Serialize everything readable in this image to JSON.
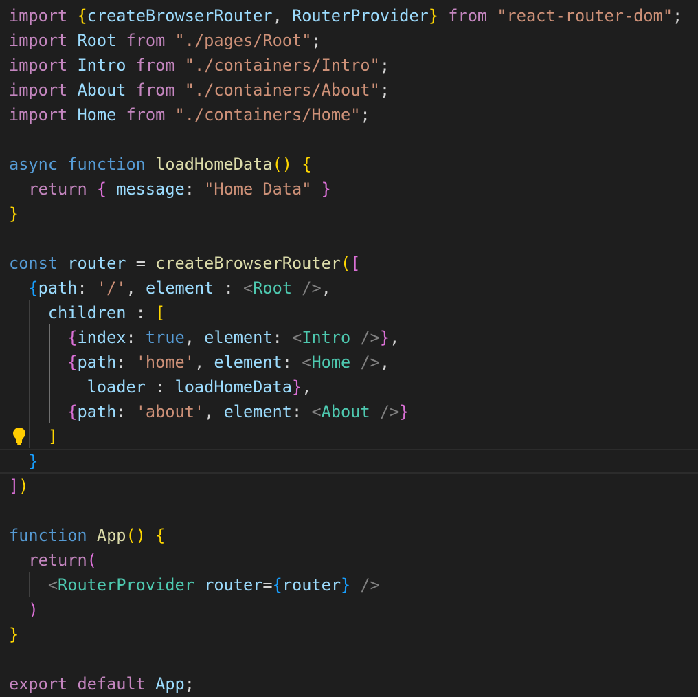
{
  "editor": {
    "language": "javascript",
    "lines": [
      [
        {
          "t": "import",
          "c": "kw"
        },
        {
          "t": " ",
          "c": "pun"
        },
        {
          "t": "{",
          "c": "b1"
        },
        {
          "t": "createBrowserRouter",
          "c": "var"
        },
        {
          "t": ", ",
          "c": "pun"
        },
        {
          "t": "RouterProvider",
          "c": "var"
        },
        {
          "t": "}",
          "c": "b1"
        },
        {
          "t": " ",
          "c": "pun"
        },
        {
          "t": "from",
          "c": "kw"
        },
        {
          "t": " ",
          "c": "pun"
        },
        {
          "t": "\"react-router-dom\"",
          "c": "str"
        },
        {
          "t": ";",
          "c": "pun"
        }
      ],
      [
        {
          "t": "import",
          "c": "kw"
        },
        {
          "t": " ",
          "c": "pun"
        },
        {
          "t": "Root",
          "c": "var"
        },
        {
          "t": " ",
          "c": "pun"
        },
        {
          "t": "from",
          "c": "kw"
        },
        {
          "t": " ",
          "c": "pun"
        },
        {
          "t": "\"./pages/Root\"",
          "c": "str"
        },
        {
          "t": ";",
          "c": "pun"
        }
      ],
      [
        {
          "t": "import",
          "c": "kw"
        },
        {
          "t": " ",
          "c": "pun"
        },
        {
          "t": "Intro",
          "c": "var"
        },
        {
          "t": " ",
          "c": "pun"
        },
        {
          "t": "from",
          "c": "kw"
        },
        {
          "t": " ",
          "c": "pun"
        },
        {
          "t": "\"./containers/Intro\"",
          "c": "str"
        },
        {
          "t": ";",
          "c": "pun"
        }
      ],
      [
        {
          "t": "import",
          "c": "kw"
        },
        {
          "t": " ",
          "c": "pun"
        },
        {
          "t": "About",
          "c": "var"
        },
        {
          "t": " ",
          "c": "pun"
        },
        {
          "t": "from",
          "c": "kw"
        },
        {
          "t": " ",
          "c": "pun"
        },
        {
          "t": "\"./containers/About\"",
          "c": "str"
        },
        {
          "t": ";",
          "c": "pun"
        }
      ],
      [
        {
          "t": "import",
          "c": "kw"
        },
        {
          "t": " ",
          "c": "pun"
        },
        {
          "t": "Home",
          "c": "var"
        },
        {
          "t": " ",
          "c": "pun"
        },
        {
          "t": "from",
          "c": "kw"
        },
        {
          "t": " ",
          "c": "pun"
        },
        {
          "t": "\"./containers/Home\"",
          "c": "str"
        },
        {
          "t": ";",
          "c": "pun"
        }
      ],
      [],
      [
        {
          "t": "async",
          "c": "st"
        },
        {
          "t": " ",
          "c": "pun"
        },
        {
          "t": "function",
          "c": "st"
        },
        {
          "t": " ",
          "c": "pun"
        },
        {
          "t": "loadHomeData",
          "c": "fn"
        },
        {
          "t": "()",
          "c": "b1"
        },
        {
          "t": " ",
          "c": "pun"
        },
        {
          "t": "{",
          "c": "b1"
        }
      ],
      [
        {
          "t": "  ",
          "c": "pun"
        },
        {
          "t": "return",
          "c": "kw"
        },
        {
          "t": " ",
          "c": "pun"
        },
        {
          "t": "{",
          "c": "b2"
        },
        {
          "t": " ",
          "c": "pun"
        },
        {
          "t": "message",
          "c": "var"
        },
        {
          "t": ": ",
          "c": "pun"
        },
        {
          "t": "\"Home Data\"",
          "c": "str"
        },
        {
          "t": " ",
          "c": "pun"
        },
        {
          "t": "}",
          "c": "b2"
        }
      ],
      [
        {
          "t": "}",
          "c": "b1"
        }
      ],
      [],
      [
        {
          "t": "const",
          "c": "st"
        },
        {
          "t": " ",
          "c": "pun"
        },
        {
          "t": "router",
          "c": "var"
        },
        {
          "t": " = ",
          "c": "pun"
        },
        {
          "t": "createBrowserRouter",
          "c": "fn"
        },
        {
          "t": "(",
          "c": "b1"
        },
        {
          "t": "[",
          "c": "b2"
        }
      ],
      [
        {
          "t": "  ",
          "c": "pun"
        },
        {
          "t": "{",
          "c": "b3"
        },
        {
          "t": "path",
          "c": "var"
        },
        {
          "t": ": ",
          "c": "pun"
        },
        {
          "t": "'/'",
          "c": "str"
        },
        {
          "t": ", ",
          "c": "pun"
        },
        {
          "t": "element",
          "c": "var"
        },
        {
          "t": " : ",
          "c": "pun"
        },
        {
          "t": "<",
          "c": "tag"
        },
        {
          "t": "Root",
          "c": "cls"
        },
        {
          "t": " />",
          "c": "tag"
        },
        {
          "t": ",",
          "c": "pun"
        }
      ],
      [
        {
          "t": "    ",
          "c": "pun"
        },
        {
          "t": "children",
          "c": "var"
        },
        {
          "t": " : ",
          "c": "pun"
        },
        {
          "t": "[",
          "c": "b1"
        }
      ],
      [
        {
          "t": "      ",
          "c": "pun"
        },
        {
          "t": "{",
          "c": "b2"
        },
        {
          "t": "index",
          "c": "var"
        },
        {
          "t": ": ",
          "c": "pun"
        },
        {
          "t": "true",
          "c": "st"
        },
        {
          "t": ", ",
          "c": "pun"
        },
        {
          "t": "element",
          "c": "var"
        },
        {
          "t": ": ",
          "c": "pun"
        },
        {
          "t": "<",
          "c": "tag"
        },
        {
          "t": "Intro",
          "c": "cls"
        },
        {
          "t": " />",
          "c": "tag"
        },
        {
          "t": "}",
          "c": "b2"
        },
        {
          "t": ",",
          "c": "pun"
        }
      ],
      [
        {
          "t": "      ",
          "c": "pun"
        },
        {
          "t": "{",
          "c": "b2"
        },
        {
          "t": "path",
          "c": "var"
        },
        {
          "t": ": ",
          "c": "pun"
        },
        {
          "t": "'home'",
          "c": "str"
        },
        {
          "t": ", ",
          "c": "pun"
        },
        {
          "t": "element",
          "c": "var"
        },
        {
          "t": ": ",
          "c": "pun"
        },
        {
          "t": "<",
          "c": "tag"
        },
        {
          "t": "Home",
          "c": "cls"
        },
        {
          "t": " />",
          "c": "tag"
        },
        {
          "t": ",",
          "c": "pun"
        }
      ],
      [
        {
          "t": "        ",
          "c": "pun"
        },
        {
          "t": "loader",
          "c": "var"
        },
        {
          "t": " : ",
          "c": "pun"
        },
        {
          "t": "loadHomeData",
          "c": "var"
        },
        {
          "t": "}",
          "c": "b2"
        },
        {
          "t": ",",
          "c": "pun"
        }
      ],
      [
        {
          "t": "      ",
          "c": "pun"
        },
        {
          "t": "{",
          "c": "b2"
        },
        {
          "t": "path",
          "c": "var"
        },
        {
          "t": ": ",
          "c": "pun"
        },
        {
          "t": "'about'",
          "c": "str"
        },
        {
          "t": ", ",
          "c": "pun"
        },
        {
          "t": "element",
          "c": "var"
        },
        {
          "t": ": ",
          "c": "pun"
        },
        {
          "t": "<",
          "c": "tag"
        },
        {
          "t": "About",
          "c": "cls"
        },
        {
          "t": " />",
          "c": "tag"
        },
        {
          "t": "}",
          "c": "b2"
        }
      ],
      [
        {
          "t": "    ",
          "c": "pun"
        },
        {
          "t": "]",
          "c": "b1"
        }
      ],
      [
        {
          "t": "  ",
          "c": "pun"
        },
        {
          "t": "}",
          "c": "b3"
        }
      ],
      [
        {
          "t": "]",
          "c": "b2"
        },
        {
          "t": ")",
          "c": "b1"
        }
      ],
      [],
      [
        {
          "t": "function",
          "c": "st"
        },
        {
          "t": " ",
          "c": "pun"
        },
        {
          "t": "App",
          "c": "fn"
        },
        {
          "t": "()",
          "c": "b1"
        },
        {
          "t": " ",
          "c": "pun"
        },
        {
          "t": "{",
          "c": "b1"
        }
      ],
      [
        {
          "t": "  ",
          "c": "pun"
        },
        {
          "t": "return",
          "c": "kw"
        },
        {
          "t": "(",
          "c": "b2"
        }
      ],
      [
        {
          "t": "    ",
          "c": "pun"
        },
        {
          "t": "<",
          "c": "tag"
        },
        {
          "t": "RouterProvider",
          "c": "cls"
        },
        {
          "t": " ",
          "c": "pun"
        },
        {
          "t": "router",
          "c": "var"
        },
        {
          "t": "=",
          "c": "pun"
        },
        {
          "t": "{",
          "c": "b3"
        },
        {
          "t": "router",
          "c": "var"
        },
        {
          "t": "}",
          "c": "b3"
        },
        {
          "t": " />",
          "c": "tag"
        }
      ],
      [
        {
          "t": "  ",
          "c": "pun"
        },
        {
          "t": ")",
          "c": "b2"
        }
      ],
      [
        {
          "t": "}",
          "c": "b1"
        }
      ],
      [],
      [
        {
          "t": "export",
          "c": "kw"
        },
        {
          "t": " ",
          "c": "pun"
        },
        {
          "t": "default",
          "c": "kw"
        },
        {
          "t": " ",
          "c": "pun"
        },
        {
          "t": "App",
          "c": "var"
        },
        {
          "t": ";",
          "c": "pun"
        }
      ]
    ],
    "current_line_index": 18,
    "lightbulb_line_index": 17,
    "icons": {
      "lightbulb": "lightbulb-icon"
    },
    "colors": {
      "background": "#1e1e1e",
      "keyword_control": "#c586c0",
      "keyword_storage": "#569cd6",
      "function": "#dcdcaa",
      "variable": "#9cdcfe",
      "string": "#ce9178",
      "component": "#4ec9b0",
      "bracket_gold": "#ffd700",
      "bracket_orchid": "#da70d6",
      "bracket_blue": "#179fff",
      "lightbulb": "#ffcc00"
    }
  }
}
